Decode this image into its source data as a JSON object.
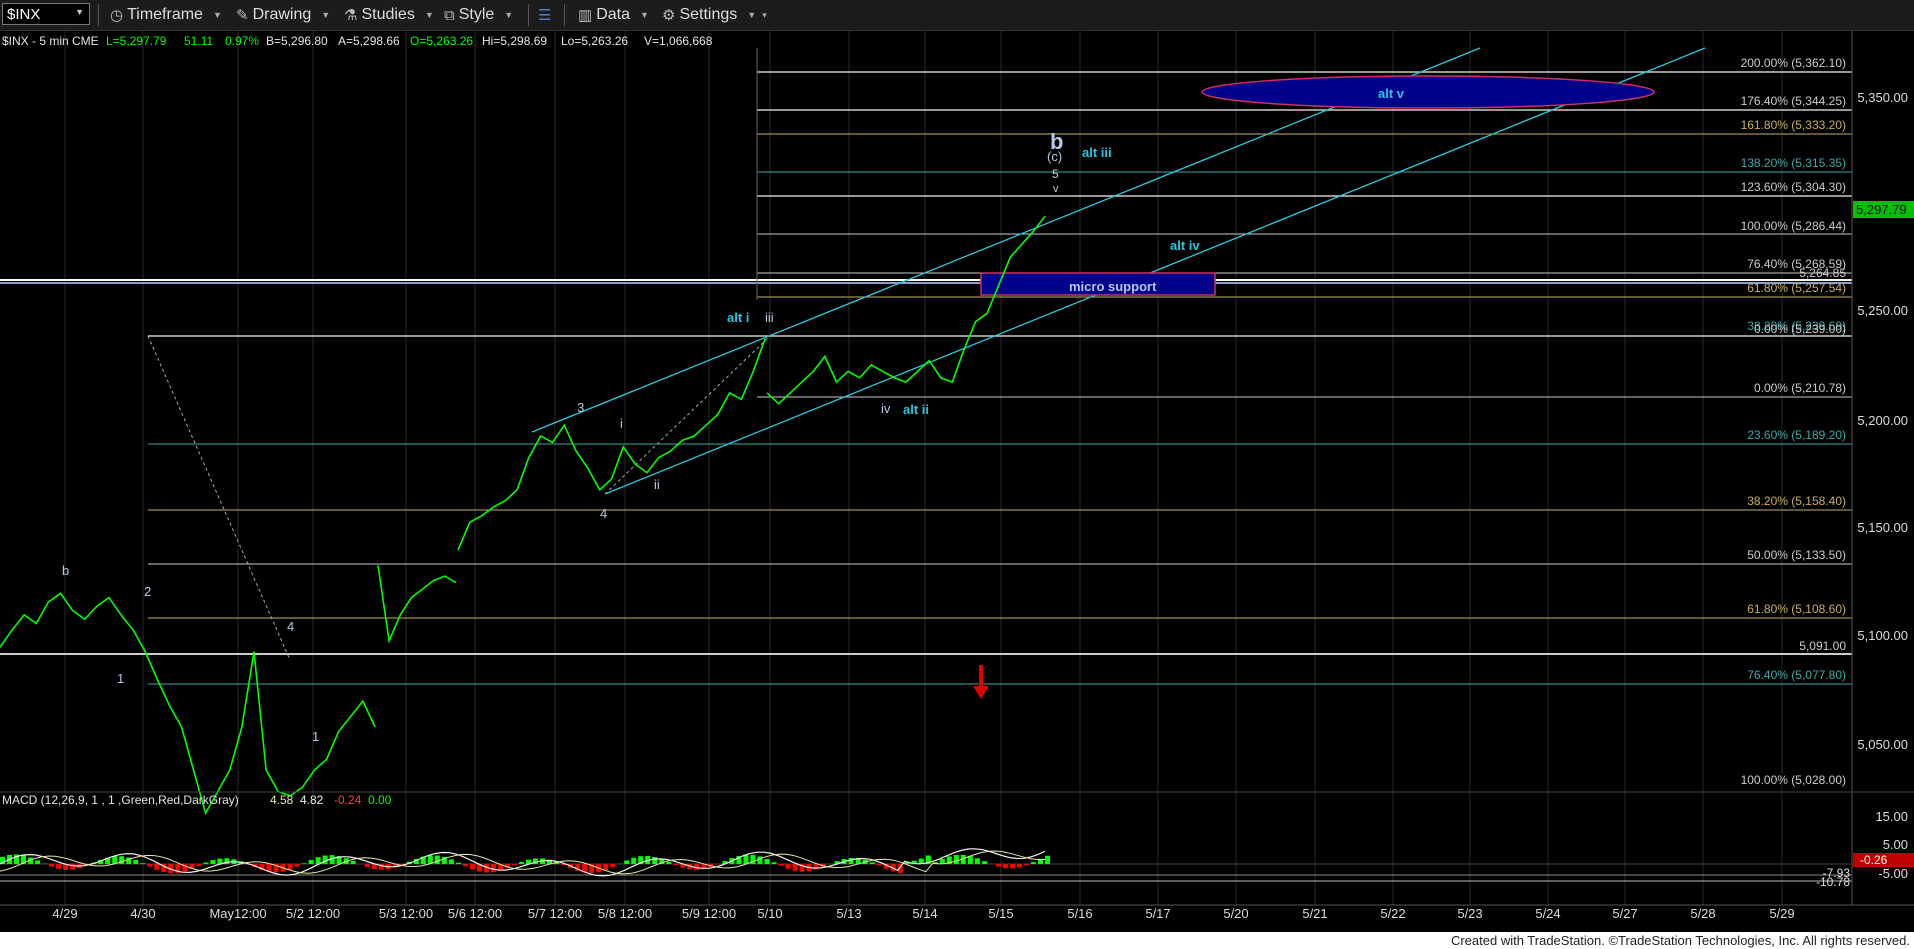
{
  "toolbar": {
    "symbol": "$INX",
    "timeframe": "Timeframe",
    "drawing": "Drawing",
    "studies": "Studies",
    "style": "Style",
    "data": "Data",
    "settings": "Settings"
  },
  "info": {
    "symbol": "$INX - 5 min  CME",
    "last": "L=5,297.79",
    "chg": "51.11",
    "pct": "0.97%",
    "bid": "B=5,296.80",
    "ask": "A=5,298.66",
    "open": "O=5,263.26",
    "hi": "Hi=5,298.69",
    "lo": "Lo=5,263.26",
    "vol": "V=1,066,668"
  },
  "macd": {
    "title": "MACD (12,26,9, 1 , 1 ,Green,Red,DarkGray)",
    "v1": "4.58",
    "v2": "4.82",
    "v3": "-0.24",
    "v4": "0.00",
    "axis": [
      "15.00",
      "5.00",
      "-5.00"
    ],
    "badges": [
      "-7.93",
      "-10.78",
      "-0.26"
    ]
  },
  "chart_data": {
    "type": "line",
    "symbol": "$INX",
    "interval": "5 min",
    "last_price": "5,297.79",
    "y_axis_ticks": [
      "5,350.00",
      "5,300.00",
      "5,250.00",
      "5,200.00",
      "5,150.00",
      "5,100.00",
      "5,050.00"
    ],
    "x_axis_ticks": [
      "4/29",
      "4/30",
      "May12:00",
      "5/2 12:00",
      "5/3 12:00",
      "5/6 12:00",
      "5/7 12:00",
      "5/8 12:00",
      "5/9 12:00",
      "5/10",
      "5/13",
      "5/14",
      "5/15",
      "5/16",
      "5/17",
      "5/20",
      "5/21",
      "5/22",
      "5/23",
      "5/24",
      "5/27",
      "5/28",
      "5/29"
    ],
    "ylim": [
      5020,
      5385
    ],
    "series": [
      {
        "values": [
          5097,
          5105,
          5112,
          5108,
          5118,
          5122,
          5114,
          5110,
          5116,
          5120,
          5112,
          5105,
          5095,
          5082,
          5070,
          5060,
          5040,
          5020,
          5030,
          5040,
          5060,
          5095,
          5040,
          5030,
          5028,
          5032,
          5040,
          5045,
          5058,
          5065,
          5072,
          5060,
          5135,
          5100,
          5112,
          5120,
          5124,
          5128,
          5130,
          5127,
          5142,
          5155,
          5158,
          5162,
          5165,
          5170,
          5185,
          5195,
          5192,
          5200,
          5188,
          5180,
          5170,
          5175,
          5190,
          5182,
          5178,
          5185,
          5188,
          5193,
          5195,
          5200,
          5205,
          5215,
          5212,
          5225,
          5240,
          5215,
          5210,
          5215,
          5220,
          5225,
          5232,
          5220,
          5225,
          5222,
          5228,
          5225,
          5222,
          5220,
          5225,
          5230,
          5222,
          5220,
          5235,
          5248,
          5252,
          5265,
          5278,
          5284,
          5290,
          5297
        ]
      }
    ],
    "fib_retracements": [
      {
        "label": "200.00% (5,362.10)",
        "color": "#cccccc"
      },
      {
        "label": "176.40% (5,344.25)",
        "color": "#cccccc"
      },
      {
        "label": "161.80% (5,333.20)",
        "color": "#c8b060"
      },
      {
        "label": "138.20% (5,315.35)",
        "color": "#3fa8a8"
      },
      {
        "label": "123.60% (5,304.30)",
        "color": "#cccccc"
      },
      {
        "label": "100.00% (5,286.44)",
        "color": "#cccccc"
      },
      {
        "label": "76.40% (5,268.59)",
        "color": "#cccccc"
      },
      {
        "label": "61.80% (5,257.54)",
        "color": "#c8b060"
      },
      {
        "label": "38.20% (5,239.69)",
        "color": "#3fa8a8"
      },
      {
        "label": "0.00% (5,239.00)",
        "color": "#cccccc"
      },
      {
        "label": "0.00% (5,210.78)",
        "color": "#cccccc"
      },
      {
        "label": "23.60% (5,189.20)",
        "color": "#3fa8a8"
      },
      {
        "label": "38.20% (5,158.40)",
        "color": "#c8b060"
      },
      {
        "label": "50.00% (5,133.50)",
        "color": "#cccccc"
      },
      {
        "label": "61.80% (5,108.60)",
        "color": "#c8b060"
      },
      {
        "label": "76.40% (5,077.80)",
        "color": "#3fa8a8"
      },
      {
        "label": "100.00% (5,028.00)",
        "color": "#cccccc"
      }
    ],
    "levels": [
      "5,264.85",
      "5,091.00"
    ],
    "annotations": [
      "b",
      "(c)",
      "5",
      "v",
      "alt iii",
      "alt iv",
      "alt v",
      "alt i",
      "iii",
      "3",
      "i",
      "ii",
      "4",
      "iv",
      "alt ii",
      "micro support",
      "2",
      "1",
      "b",
      "1",
      "4",
      "1"
    ],
    "colors": {
      "price": "#00ff00",
      "channel": "#29c8e0",
      "target_zone": "#00008b",
      "macd_line": "#f0f0f0",
      "signal_line": "#e8e8a0",
      "hist_up": "#00ff00",
      "hist_down": "#ff0000",
      "arrow": "#e00000"
    }
  },
  "footer": {
    "credit": "Created with TradeStation. ©TradeStation Technologies, Inc. All rights reserved."
  }
}
